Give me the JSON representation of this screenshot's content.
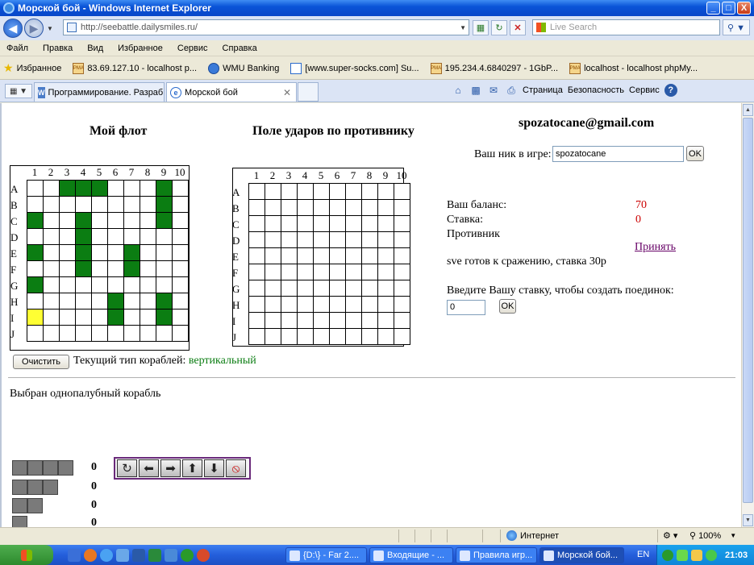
{
  "window": {
    "title": "Морской бой - Windows Internet Explorer",
    "buttons": [
      "_",
      "□",
      "X"
    ]
  },
  "address": {
    "url": "http://seebattle.dailysmiles.ru/",
    "search_placeholder": "Live Search"
  },
  "menu": [
    "Файл",
    "Правка",
    "Вид",
    "Избранное",
    "Сервис",
    "Справка"
  ],
  "favorites": {
    "label": "Избранное",
    "items": [
      "83.69.127.10 - localhost p...",
      "WMU Banking",
      "[www.super-socks.com] Su...",
      "195.234.4.6840297 - 1GbP...",
      "localhost - localhost phpMy..."
    ]
  },
  "tabs": [
    {
      "label": "Программирование. Разраб...",
      "icon": "W",
      "active": false
    },
    {
      "label": "Морской бой",
      "icon": "e",
      "active": true
    }
  ],
  "commandbar": {
    "page": "Страница",
    "safety": "Безопасность",
    "tools": "Сервис"
  },
  "game": {
    "fleet_title": "Мой флот",
    "enemy_title": "Поле ударов по противнику",
    "email": "spozatocane@gmail.com",
    "nick_label": "Ваш ник в игре:",
    "nick_value": "spozatocane",
    "ok_label": "OK",
    "balance_label": "Ваш баланс:",
    "balance_value": "70",
    "stake_label": "Ставка:",
    "stake_value": "0",
    "opponent_label": "Противник",
    "accept_link": "Принять",
    "ready_text": "sve готов к сражению, ставка 30р",
    "bet_prompt": "Введите Вашу ставку, чтобы создать поединок:",
    "bet_value": "0",
    "clear_label": "Очистить",
    "ship_type_label": "Текущий тип кораблей:",
    "ship_type_value": "вертикальный",
    "selected_text": "Выбран однопалубный корабль",
    "columns": [
      "1",
      "2",
      "3",
      "4",
      "5",
      "6",
      "7",
      "8",
      "9",
      "10"
    ],
    "rows": [
      "A",
      "B",
      "C",
      "D",
      "E",
      "F",
      "G",
      "H",
      "I",
      "J"
    ],
    "fleet_ships": [
      [
        0,
        2
      ],
      [
        0,
        3
      ],
      [
        0,
        4
      ],
      [
        0,
        8
      ],
      [
        1,
        8
      ],
      [
        2,
        8
      ],
      [
        2,
        0
      ],
      [
        2,
        3
      ],
      [
        3,
        3
      ],
      [
        4,
        3
      ],
      [
        5,
        3
      ],
      [
        4,
        0
      ],
      [
        4,
        6
      ],
      [
        5,
        6
      ],
      [
        6,
        0
      ],
      [
        7,
        5
      ],
      [
        8,
        5
      ],
      [
        7,
        8
      ],
      [
        8,
        8
      ]
    ],
    "fleet_selected": [
      [
        8,
        0
      ]
    ],
    "ship_inventory": [
      {
        "decks": 4,
        "count": "0"
      },
      {
        "decks": 3,
        "count": "0"
      },
      {
        "decks": 2,
        "count": "0"
      },
      {
        "decks": 1,
        "count": "0"
      }
    ],
    "controls": [
      "rotate-icon",
      "arrow-left-icon",
      "arrow-right-icon",
      "arrow-up-icon",
      "arrow-down-icon",
      "stop-icon"
    ]
  },
  "status": {
    "zone": "Интернет",
    "zoom": "100%"
  },
  "taskbar": {
    "tasks": [
      {
        "label": "{D:\\} - Far 2....",
        "active": false
      },
      {
        "label": "Входящие - ...",
        "active": false
      },
      {
        "label": "Правила игр...",
        "active": false
      },
      {
        "label": "Морской бой...",
        "active": true
      }
    ],
    "lang": "EN",
    "clock": "21:03"
  },
  "colors": {
    "ship": "#0b7d12",
    "selected": "#ffff33",
    "balance": "#cc0000",
    "link": "#660066"
  }
}
